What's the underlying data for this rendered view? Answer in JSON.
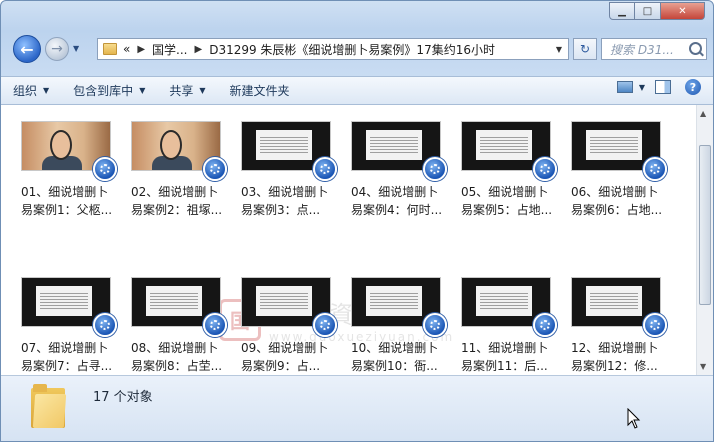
{
  "window": {
    "caption_buttons": {
      "minimize": "▁",
      "maximize": "□",
      "close": "✕"
    }
  },
  "nav": {
    "breadcrumb": [
      "«",
      "国学...",
      "D31299 朱辰彬《细说增删卜易案例》17集约16小时"
    ],
    "search_placeholder": "搜索 D31..."
  },
  "toolbar": {
    "items": [
      "组织",
      "包含到库中",
      "共享",
      "新建文件夹"
    ]
  },
  "files": [
    {
      "line1": "01、细说增删卜",
      "line2": "易案例1：父柩...",
      "thumb": "video"
    },
    {
      "line1": "02、细说增删卜",
      "line2": "易案例2：祖塚...",
      "thumb": "video"
    },
    {
      "line1": "03、细说增删卜",
      "line2": "易案例3：点...",
      "thumb": "screen"
    },
    {
      "line1": "04、细说增删卜",
      "line2": "易案例4：何时...",
      "thumb": "screen"
    },
    {
      "line1": "05、细说增删卜",
      "line2": "易案例5：占地...",
      "thumb": "screen"
    },
    {
      "line1": "06、细说增删卜",
      "line2": "易案例6：占地...",
      "thumb": "screen"
    },
    {
      "line1": "07、细说增删卜",
      "line2": "易案例7：占寻...",
      "thumb": "screen"
    },
    {
      "line1": "08、细说增删卜",
      "line2": "易案例8：占茔...",
      "thumb": "screen"
    },
    {
      "line1": "09、细说增删卜",
      "line2": "易案例9：占...",
      "thumb": "screen"
    },
    {
      "line1": "10、细说增删卜",
      "line2": "易案例10：衙...",
      "thumb": "screen"
    },
    {
      "line1": "11、细说增删卜",
      "line2": "易案例11：后...",
      "thumb": "screen"
    },
    {
      "line1": "12、细说增删卜",
      "line2": "易案例12：修...",
      "thumb": "screen"
    }
  ],
  "watermark": {
    "seal": "国",
    "cn": "國學資源網",
    "url": "www.guoxueziyuan.com"
  },
  "status": {
    "count": "17 个对象"
  }
}
